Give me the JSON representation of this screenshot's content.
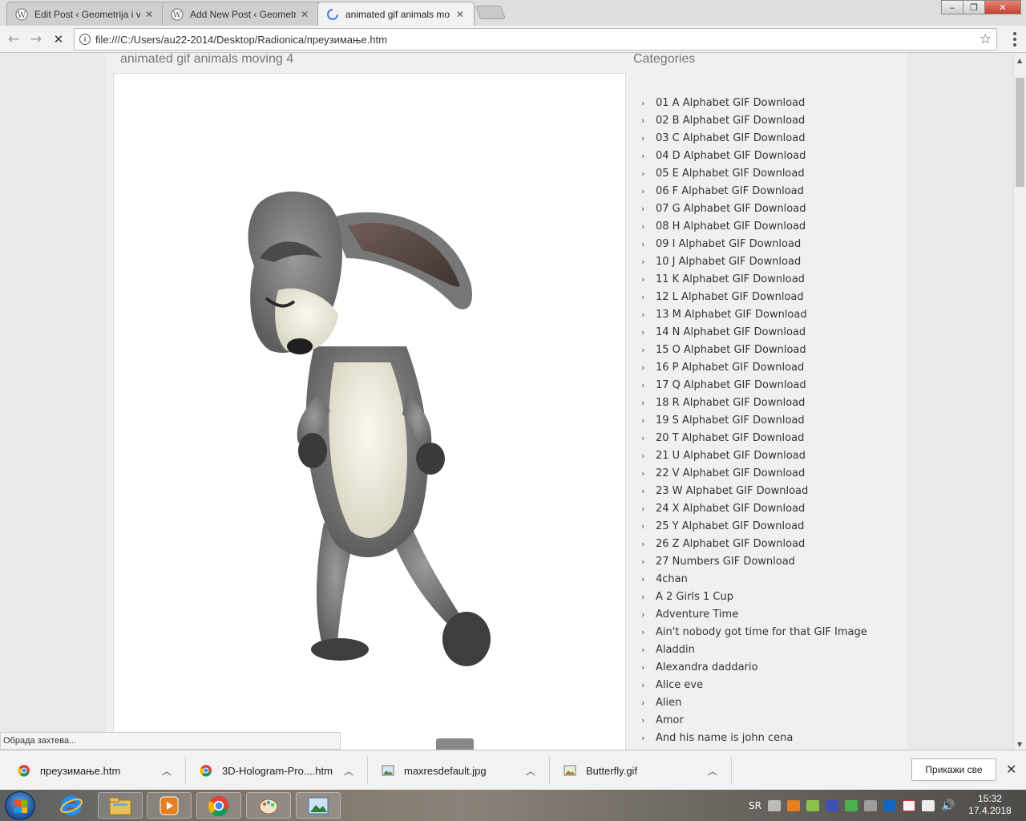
{
  "browser": {
    "tabs": [
      {
        "title": "Edit Post ‹ Geometrija i v",
        "favicon": "wordpress-icon",
        "active": false
      },
      {
        "title": "Add New Post ‹ Geometr",
        "favicon": "wordpress-icon",
        "active": false
      },
      {
        "title": "animated gif animals mo",
        "favicon": "loading-spinner-icon",
        "active": true
      }
    ],
    "address": "file:///C:/Users/au22-2014/Desktop/Radionica/преузимање.htm",
    "window_controls": {
      "minimize": "‒",
      "maximize": "❐",
      "close": "✕"
    },
    "nav": {
      "back": "←",
      "forward": "→",
      "stop": "✕"
    }
  },
  "page": {
    "post_title": "animated gif animals moving 4",
    "sidebar_title": "Categories",
    "categories": [
      "01 A Alphabet GIF Download",
      "02 B Alphabet GIF Download",
      "03 C Alphabet GIF Download",
      "04 D Alphabet GIF Download",
      "05 E Alphabet GIF Download",
      "06 F Alphabet GIF Download",
      "07 G Alphabet GIF Download",
      "08 H Alphabet GIF Download",
      "09 I Alphabet GIF Download",
      "10 J Alphabet GIF Download",
      "11 K Alphabet GIF Download",
      "12 L Alphabet GIF Download",
      "13 M Alphabet GIF Download",
      "14 N Alphabet GIF Download",
      "15 O Alphabet GIF Download",
      "16 P Alphabet GIF Download",
      "17 Q Alphabet GIF Download",
      "18 R Alphabet GIF Download",
      "19 S Alphabet GIF Download",
      "20 T Alphabet GIF Download",
      "21 U Alphabet GIF Download",
      "22 V Alphabet GIF Download",
      "23 W Alphabet GIF Download",
      "24 X Alphabet GIF Download",
      "25 Y Alphabet GIF Download",
      "26 Z Alphabet GIF Download",
      "27 Numbers GIF Download",
      "4chan",
      "A 2 Girls 1 Cup",
      "Adventure Time",
      "Ain't nobody got time for that GIF Image",
      "Aladdin",
      "Alexandra daddario",
      "Alice eve",
      "Alien",
      "Amor",
      "And his name is john cena"
    ]
  },
  "status_text": "Обрада захтева...",
  "downloads": {
    "items": [
      {
        "name": "преузимање.htm",
        "icon": "chrome-icon"
      },
      {
        "name": "3D-Hologram-Pro....htm",
        "icon": "chrome-icon"
      },
      {
        "name": "maxresdefault.jpg",
        "icon": "image-file-icon"
      },
      {
        "name": "Butterfly.gif",
        "icon": "image-file-icon"
      }
    ],
    "show_all": "Прикажи све"
  },
  "taskbar": {
    "pinned": [
      "internet-explorer-icon",
      "file-explorer-icon",
      "media-player-icon",
      "chrome-icon",
      "paint-icon",
      "photo-viewer-icon"
    ],
    "language": "SR",
    "time": "15:32",
    "date": "17.4.2018"
  },
  "colors": {
    "link_text": "#333333",
    "title_text": "#777777",
    "content_bg": "#ffffff",
    "page_bg": "#e9e9e9"
  }
}
